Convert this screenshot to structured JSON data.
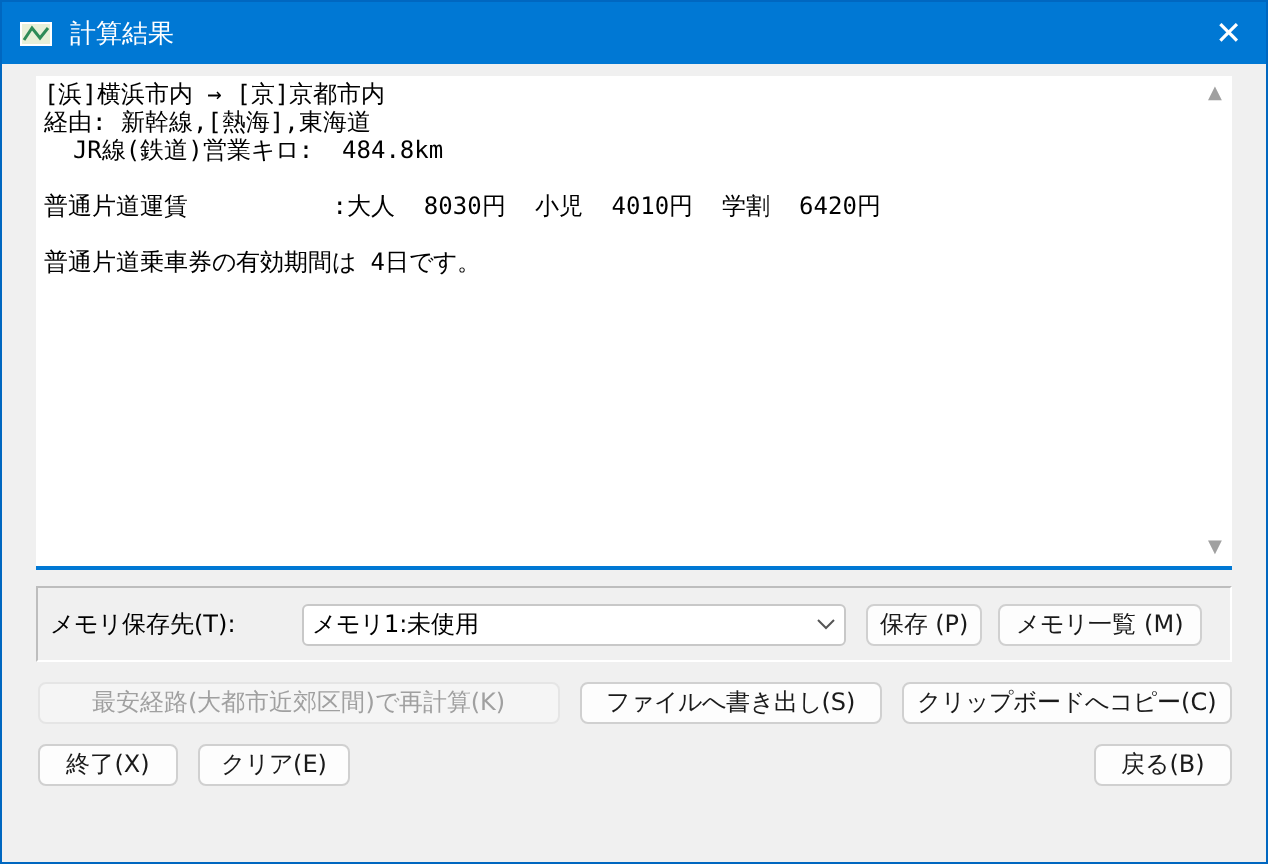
{
  "window": {
    "title": "計算結果",
    "close": "✕"
  },
  "result": {
    "paragraphs": [
      [
        "[浜]横浜市内 → [京]京都市内",
        "経由: 新幹線,[熱海],東海道",
        "  JR線(鉄道)営業キロ:  484.8km"
      ],
      [
        "普通片道運賃          :大人  8030円  小児  4010円  学割  6420円"
      ],
      [
        "普通片道乗車券の有効期間は 4日です。"
      ]
    ],
    "scroll_up": "▲",
    "scroll_down": "▼"
  },
  "memory": {
    "label": "メモリ保存先(T):",
    "value": "メモリ1:未使用",
    "buttons": [
      {
        "label": "保存 (P)",
        "disabled": false
      },
      {
        "label": "メモリ一覧 (M)",
        "disabled": false
      }
    ]
  },
  "actions": [
    {
      "label": "最安経路(大都市近郊区間)で再計算(K)",
      "disabled": true
    },
    {
      "label": "ファイルへ書き出し(S)",
      "disabled": false
    },
    {
      "label": "クリップボードへコピー(C)",
      "disabled": false
    }
  ],
  "footer_left": [
    {
      "label": "終了(X)",
      "disabled": false
    },
    {
      "label": "クリア(E)",
      "disabled": false
    }
  ],
  "footer_right": [
    {
      "label": "戻る(B)",
      "disabled": false
    }
  ]
}
